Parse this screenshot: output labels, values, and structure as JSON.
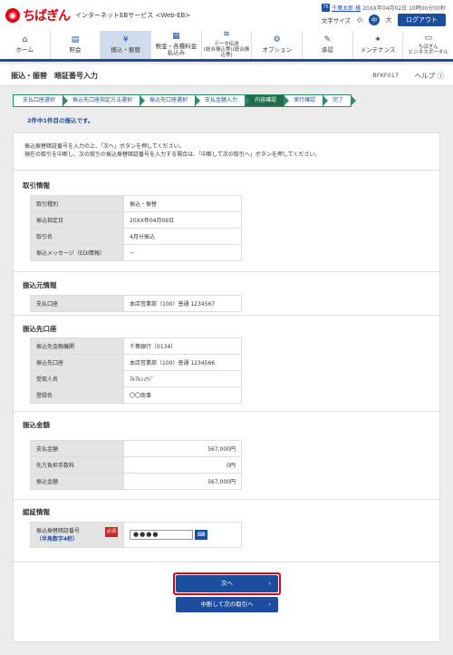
{
  "header": {
    "logo_text": "ちばぎん",
    "service_name": "インターネットEBサービス <Web-EB>",
    "user_icon": "75",
    "user_name": "千葉太郎 様",
    "last_login": "20XX年04月02日 10時00分00秒",
    "font_size_label": "文字サイズ",
    "font_sizes": [
      "小",
      "中",
      "大"
    ],
    "logout_label": "ログアウト"
  },
  "nav": [
    {
      "label": "ホーム",
      "icon": "home-icon",
      "glyph": "⌂"
    },
    {
      "label": "照会",
      "icon": "inquiry-icon",
      "glyph": "▤"
    },
    {
      "label": "振込・振替",
      "icon": "transfer-icon",
      "glyph": "¥"
    },
    {
      "label": "税金・各種料金\n払込み",
      "icon": "tax-icon",
      "glyph": "▦"
    },
    {
      "label": "データ伝送\n(総合振込等)(総合振込等)",
      "icon": "data-icon",
      "glyph": "≋"
    },
    {
      "label": "オプション",
      "icon": "option-icon",
      "glyph": "⚙"
    },
    {
      "label": "承認",
      "icon": "approve-icon",
      "glyph": "✎"
    },
    {
      "label": "メンテナンス",
      "icon": "maintenance-icon",
      "glyph": "✦"
    },
    {
      "label": "ちばぎん\nビジネスポータル",
      "icon": "portal-icon",
      "glyph": "▭"
    }
  ],
  "page": {
    "title": "振込・振替　暗証番号入力",
    "id": "BFKF017",
    "help": "ヘルプ"
  },
  "steps": [
    "支払口座選択",
    "振込先口座指定方法選択",
    "振込先口座選択",
    "支払金額入力",
    "内容確認",
    "実行確認",
    "完了"
  ],
  "progress": "2件中1件目の振込です。",
  "message": {
    "line1": "振込振替暗証番号を入力の上、「次へ」ボタンを押してください。",
    "line2": "現在の取引を中断し、次の取引の振込振替暗証番号を入力する場合は、「中断して次の取引へ」ボタンを押してください。"
  },
  "sections": {
    "torihiki": {
      "title": "取引情報",
      "rows": [
        {
          "label": "取引種別",
          "value": "振込・振替"
        },
        {
          "label": "振込指定日",
          "value": "20XX年04月09日"
        },
        {
          "label": "取引名",
          "value": "4月分振込"
        },
        {
          "label": "振込メッセージ（EDI情報）",
          "value": "－"
        }
      ]
    },
    "moto": {
      "title": "振込元情報",
      "rows": [
        {
          "label": "支払口座",
          "value": "本店営業部（100）普通 1234567"
        }
      ]
    },
    "saki": {
      "title": "振込先口座",
      "rows": [
        {
          "label": "振込先金融機関",
          "value": "千葉銀行（0134）"
        },
        {
          "label": "振込先口座",
          "value": "本店営業部（100）普通 1234566"
        },
        {
          "label": "受取人名",
          "value": "ﾏﾙﾏﾙｼｮｳｼﾞ"
        },
        {
          "label": "登録名",
          "value": "〇〇商事"
        }
      ]
    },
    "kingaku": {
      "title": "振込金額",
      "rows": [
        {
          "label": "支払金額",
          "value": "567,000円"
        },
        {
          "label": "先方負担手数料",
          "value": "0円"
        },
        {
          "label": "振込金額",
          "value": "567,000円"
        }
      ]
    },
    "ninsho": {
      "title": "認証情報",
      "label": "振込振替暗証番号",
      "sublabel": "（半角数字4桁）",
      "required": "必須",
      "value": "●●●●",
      "keyboard_label": "⌨"
    }
  },
  "buttons": {
    "next": "次へ",
    "next_arrow": "›",
    "suspend": "中断して次の取引へ",
    "suspend_arrow": "›"
  }
}
